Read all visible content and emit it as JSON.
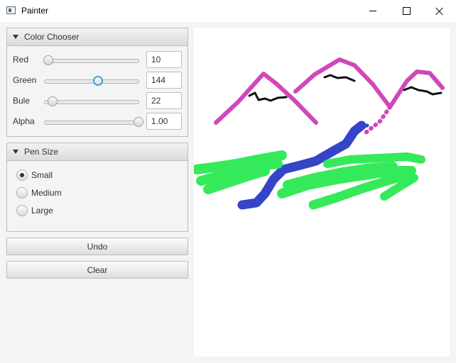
{
  "window": {
    "title": "Painter"
  },
  "color_chooser": {
    "title": "Color Chooser",
    "red": {
      "label": "Red",
      "value": "10",
      "slider_fraction": 0.039
    },
    "green": {
      "label": "Green",
      "value": "144",
      "slider_fraction": 0.565
    },
    "blue": {
      "label": "Bule",
      "value": "22",
      "slider_fraction": 0.086
    },
    "alpha": {
      "label": "Alpha",
      "value": "1.00",
      "slider_fraction": 1.0
    }
  },
  "pen_size": {
    "title": "Pen Size",
    "options": [
      {
        "label": "Small",
        "selected": true
      },
      {
        "label": "Medium",
        "selected": false
      },
      {
        "label": "Large",
        "selected": false
      }
    ]
  },
  "buttons": {
    "undo": "Undo",
    "clear": "Clear"
  },
  "colors": {
    "accent": "#3ba3d8",
    "stroke_magenta": "#d048b8",
    "stroke_black": "#111111",
    "stroke_blue": "#3545c8",
    "stroke_green": "#35ea5a"
  }
}
